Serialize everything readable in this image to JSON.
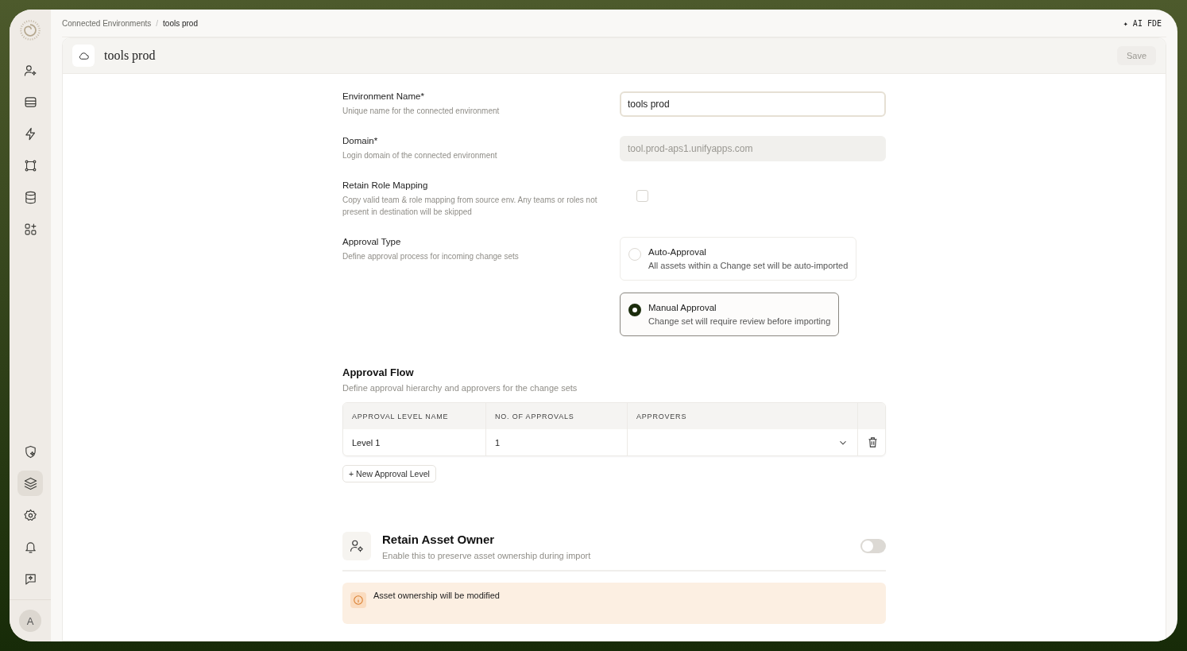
{
  "sidebar": {
    "top": [
      {
        "kind": "user",
        "selected": false
      },
      {
        "kind": "card",
        "selected": false
      },
      {
        "kind": "bolt",
        "selected": false
      },
      {
        "kind": "nodes",
        "selected": false
      },
      {
        "kind": "database",
        "selected": false
      },
      {
        "kind": "apps",
        "selected": false
      }
    ],
    "bottom": [
      {
        "kind": "shield",
        "selected": false
      },
      {
        "kind": "layers",
        "selected": true
      },
      {
        "kind": "settings",
        "selected": false
      },
      {
        "kind": "bell",
        "selected": false
      },
      {
        "kind": "chat",
        "selected": false
      }
    ],
    "avatar": "A"
  },
  "breadcrumb": {
    "items": [
      "Connected Environments",
      "tools prod"
    ],
    "separator": "/"
  },
  "ai_button": "✦ AI FDE",
  "header": {
    "title": "tools prod",
    "save": "Save",
    "save_disabled": true
  },
  "fields": [
    {
      "kind": "input",
      "label": "Environment Name*",
      "hint": "Unique name for the connected environment",
      "value": "tools prod",
      "disabled": false
    },
    {
      "kind": "input",
      "label": "Domain*",
      "hint": "Login domain of the connected environment",
      "value": "tool.prod-aps1.unifyapps.com",
      "disabled": true
    },
    {
      "kind": "checkbox",
      "label": "Retain Role Mapping",
      "hint": "Copy valid team & role mapping from source env. Any teams or roles not present in destination will be skipped",
      "checked": false
    },
    {
      "kind": "radio",
      "label": "Approval Type",
      "hint": "Define approval process for incoming change sets",
      "options": [
        {
          "title": "Auto-Approval",
          "text": "All assets within a Change set will be auto-imported",
          "selected": false
        },
        {
          "title": "Manual Approval",
          "text": "Change set will require review before importing",
          "selected": true
        }
      ]
    }
  ],
  "approval_flow": {
    "title": "Approval Flow",
    "subtitle": "Define approval hierarchy and approvers for the change sets",
    "columns": [
      "APPROVAL LEVEL NAME",
      "NO. OF APPROVALS",
      "APPROVERS"
    ],
    "rows": [
      {
        "name": "Level 1",
        "count": "1"
      }
    ],
    "add_button": "+ New Approval Level"
  },
  "retain_owner": {
    "title": "Retain Asset Owner",
    "subtitle": "Enable this to preserve asset ownership during import",
    "on": false
  },
  "alert": {
    "title": "Asset ownership will be modified"
  }
}
